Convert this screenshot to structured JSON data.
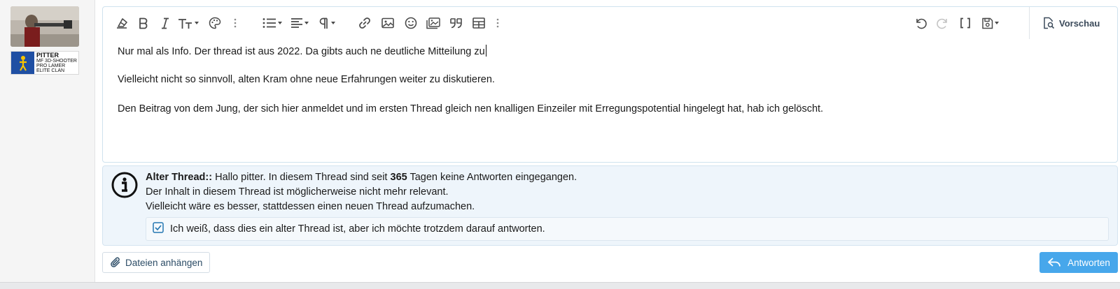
{
  "user": {
    "badge_name": "PITTER",
    "badge_line1": "MF 3D-SHOOTER",
    "badge_line2": "PRO LAMER",
    "badge_line3": "ELITE CLAN"
  },
  "toolbar": {
    "icons": [
      "eraser-icon",
      "bold-icon",
      "italic-icon",
      "text-size-icon",
      "palette-icon",
      "more-icon",
      "list-icon",
      "align-icon",
      "paragraph-icon",
      "link-icon",
      "image-icon",
      "smiley-icon",
      "media-icon",
      "quote-icon",
      "table-icon",
      "more-icon",
      "undo-icon",
      "redo-icon",
      "bbcode-icon",
      "save-draft-icon",
      "preview-icon"
    ],
    "preview_label": "Vorschau"
  },
  "editor": {
    "line1": "Nur mal als Info. Der thread ist aus 2022. Da gibts auch ne deutliche Mitteilung zu",
    "line2": "Vielleicht nicht so sinnvoll, alten Kram ohne neue Erfahrungen weiter zu diskutieren.",
    "line3": "Den Beitrag von dem Jung, der sich hier anmeldet und im ersten Thread gleich nen knalligen Einzeiler mit Erregungspotential hingelegt hat, hab ich gelöscht."
  },
  "notice": {
    "title": "Alter Thread::",
    "text_before": " Hallo pitter. In diesem Thread sind seit ",
    "days": "365",
    "text_after": " Tagen keine Antworten eingegangen.",
    "line2": "Der Inhalt in diesem Thread ist möglicherweise nicht mehr relevant.",
    "line3": "Vielleicht wäre es besser, stattdessen einen neuen Thread aufzumachen.",
    "ack_label": "Ich weiß, dass dies ein alter Thread ist, aber ich möchte trotzdem darauf antworten.",
    "ack_checked": true
  },
  "footer": {
    "attach_label": "Dateien anhängen",
    "reply_label": "Antworten"
  },
  "colors": {
    "accent": "#47a7eb",
    "notice_bg": "#eef5fb",
    "sidebar_bg": "#f5f5f5"
  }
}
